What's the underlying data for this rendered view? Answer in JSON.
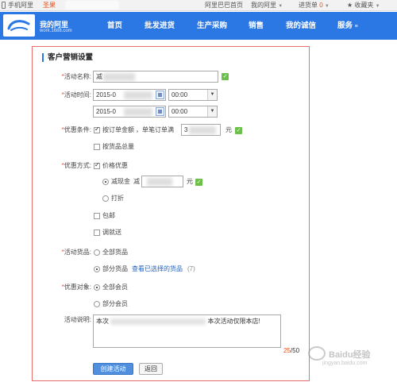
{
  "topbar": {
    "mobile": "手机阿里",
    "user_prefix": "圣果",
    "alibaba_home": "阿里巴巴首页",
    "my_alibaba": "我的阿里",
    "purchase": "进货单",
    "purchase_count": "0",
    "favorites": "收藏夹"
  },
  "nav": {
    "brand": "我的阿里",
    "brand_url": "work.1688.com",
    "items": [
      {
        "label": "首页"
      },
      {
        "label": "批发进货"
      },
      {
        "label": "生产采购"
      },
      {
        "label": "销售"
      },
      {
        "label": "我的诚信"
      },
      {
        "label": "服务"
      }
    ]
  },
  "form": {
    "title": "客户营销设置",
    "name": {
      "label": "活动名称:",
      "value": "减"
    },
    "time": {
      "label": "活动时间:",
      "start_date": "2015-0",
      "start_time": "00:00",
      "end_date": "2015-0",
      "end_time": "00:00"
    },
    "condition": {
      "label": "优惠条件:",
      "opt_amount": "按订单金额",
      "amount_text": "，单笔订单满",
      "amount_value": "3",
      "unit": "元",
      "opt_quantity": "按货品总量"
    },
    "method": {
      "label": "优惠方式:",
      "price": "价格优惠",
      "cash": "减现金",
      "cash_prefix": "减",
      "unit": "元",
      "discount": "打折",
      "free_shipping": "包邮",
      "gift": "调就送"
    },
    "goods": {
      "label": "活动货品:",
      "all": "全部货品",
      "partial": "部分货品",
      "view_link": "查看已选择的货品",
      "count": "(7)"
    },
    "target": {
      "label": "优惠对象:",
      "all": "全部会员",
      "partial": "部分会员"
    },
    "desc": {
      "label": "活动说明:",
      "value_start": "本次",
      "value_end": "本次活动仅限本店!",
      "count_current": "25",
      "count_max": "/50"
    },
    "submit": "创建活动",
    "back": "返回"
  },
  "watermark": {
    "text": "Baidu经验",
    "sub": "jingyan.baidu.com"
  },
  "colors": {
    "nav_blue": "#2b78e4",
    "panel_border": "#e96f6f",
    "required": "#e84c3d",
    "ok_green": "#6cc04a",
    "primary_button": "#4f8fde"
  }
}
